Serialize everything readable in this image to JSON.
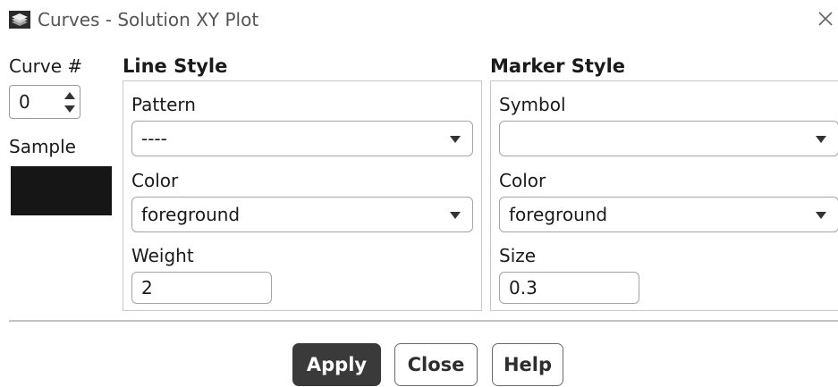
{
  "window": {
    "title": "Curves - Solution XY Plot",
    "app_icon": "ansys-fluent-icon",
    "close_icon": "close-icon"
  },
  "curve": {
    "label": "Curve #",
    "value": "0"
  },
  "sample": {
    "label": "Sample",
    "swatch_color": "#161616"
  },
  "line_style": {
    "title": "Line Style",
    "pattern_label": "Pattern",
    "pattern_value": "----",
    "color_label": "Color",
    "color_value": "foreground",
    "weight_label": "Weight",
    "weight_value": "2"
  },
  "marker_style": {
    "title": "Marker Style",
    "symbol_label": "Symbol",
    "symbol_value": "",
    "color_label": "Color",
    "color_value": "foreground",
    "size_label": "Size",
    "size_value": "0.3"
  },
  "buttons": {
    "apply": "Apply",
    "close": "Close",
    "help": "Help"
  },
  "colors": {
    "primary_button": "#3a3a3a",
    "border": "#a4a4a4"
  }
}
